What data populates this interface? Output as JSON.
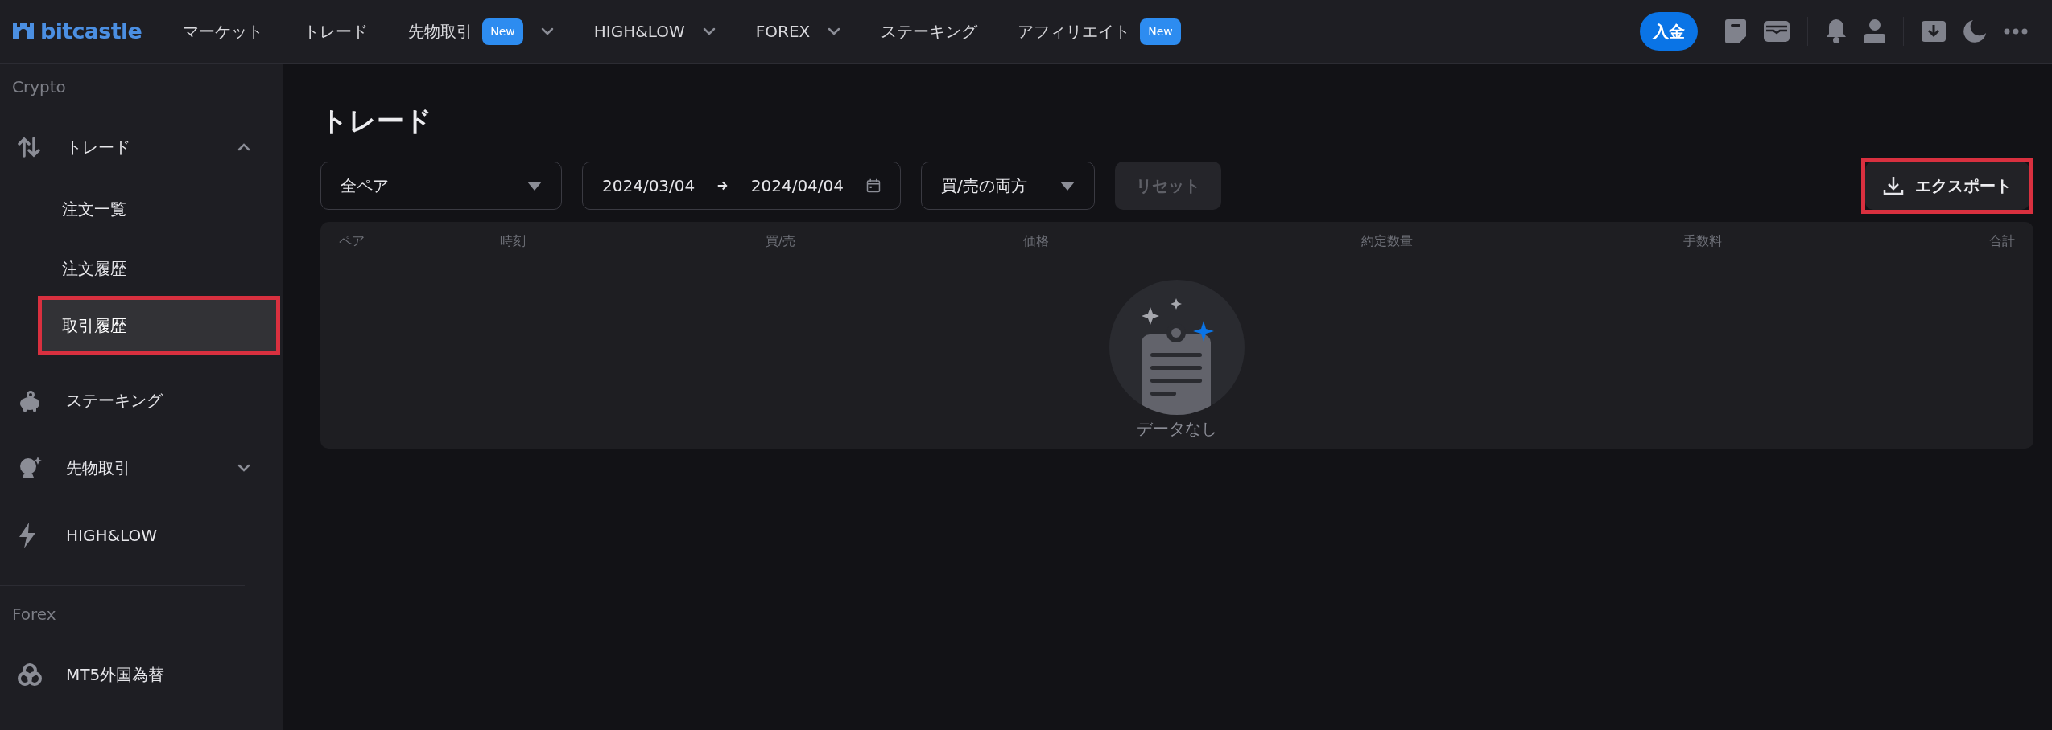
{
  "header": {
    "logo": "bitcastle",
    "nav": [
      {
        "label": "マーケット",
        "dropdown": false
      },
      {
        "label": "トレード",
        "dropdown": false
      },
      {
        "label": "先物取引",
        "badge": "New",
        "dropdown": true
      },
      {
        "label": "HIGH&LOW",
        "dropdown": true
      },
      {
        "label": "FOREX",
        "dropdown": true
      },
      {
        "label": "ステーキング",
        "dropdown": false
      },
      {
        "label": "アフィリエイト",
        "badge": "New",
        "dropdown": false
      }
    ],
    "deposit_button": "入金"
  },
  "sidebar": {
    "sections": [
      {
        "title": "Crypto",
        "items": [
          {
            "kind": "trade",
            "label": "トレード",
            "expanded": true,
            "children": [
              {
                "label": "注文一覧",
                "selected": false,
                "highlighted": false
              },
              {
                "label": "注文履歴",
                "selected": false,
                "highlighted": false
              },
              {
                "label": "取引履歴",
                "selected": true,
                "highlighted": true
              }
            ]
          },
          {
            "kind": "staking",
            "label": "ステーキング"
          },
          {
            "kind": "futures",
            "label": "先物取引",
            "expanded": false
          },
          {
            "kind": "bolt",
            "label": "HIGH&LOW"
          }
        ]
      },
      {
        "title": "Forex",
        "items": [
          {
            "kind": "rings",
            "label": "MT5外国為替"
          }
        ]
      }
    ]
  },
  "page": {
    "title": "トレード",
    "filters": {
      "pair": "全ペア",
      "date_from": "2024/03/04",
      "date_to": "2024/04/04",
      "side": "買/売の両方",
      "reset_button": "リセット"
    },
    "export_button": {
      "label": "エクスポート",
      "highlighted": true
    },
    "table": {
      "columns": [
        "ペア",
        "時刻",
        "買/売",
        "価格",
        "約定数量",
        "手数料",
        "合計"
      ],
      "empty_text": "データなし"
    }
  }
}
